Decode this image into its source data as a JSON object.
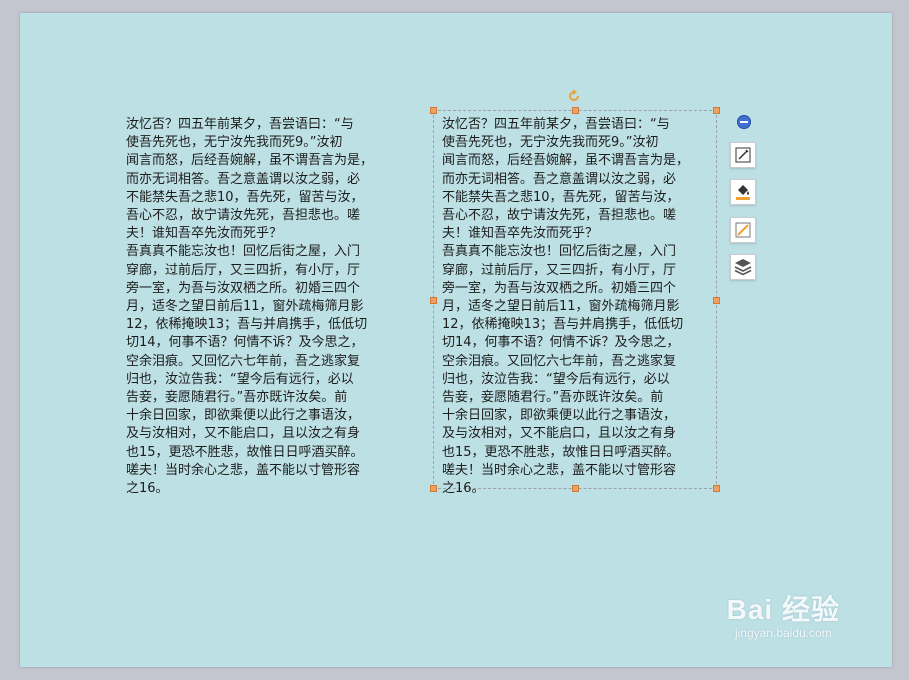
{
  "text_boxes": {
    "left": "汝忆否？四五年前某夕，吾尝语曰：“与\n使吾先死也，无宁汝先我而死9。”汝初\n闻言而怒，后经吾婉解，虽不谓吾言为是，\n而亦无词相答。吾之意盖谓以汝之弱，必\n不能禁失吾之悲10，吾先死，留苦与汝，\n吾心不忍，故宁请汝先死，吾担悲也。嗟\n夫！谁知吾卒先汝而死乎？\n吾真真不能忘汝也！回忆后街之屋，入门\n穿廊，过前后厅，又三四折，有小厅，厅\n旁一室，为吾与汝双栖之所。初婚三四个\n月，适冬之望日前后11，窗外疏梅筛月影\n12，依稀掩映13；吾与并肩携手，低低切\n切14，何事不语？何情不诉？及今思之，\n空余泪痕。又回忆六七年前，吾之逃家复\n归也，汝泣告我：“望今后有远行，必以\n告妾，妾愿随君行。”吾亦既许汝矣。前\n十余日回家，即欲乘便以此行之事语汝，\n及与汝相对，又不能启口，且以汝之有身\n也15，更恐不胜悲，故惟日日呼酒买醉。\n嗟夫！当时余心之悲，盖不能以寸管形容\n之16。",
    "right": "汝忆否？四五年前某夕，吾尝语曰：“与\n使吾先死也，无宁汝先我而死9。”汝初\n闻言而怒，后经吾婉解，虽不谓吾言为是，\n而亦无词相答。吾之意盖谓以汝之弱，必\n不能禁失吾之悲10，吾先死，留苦与汝，\n吾心不忍，故宁请汝先死，吾担悲也。嗟\n夫！谁知吾卒先汝而死乎？\n吾真真不能忘汝也！回忆后街之屋，入门\n穿廊，过前后厅，又三四折，有小厅，厅\n旁一室，为吾与汝双栖之所。初婚三四个\n月，适冬之望日前后11，窗外疏梅筛月影\n12，依稀掩映13；吾与并肩携手，低低切\n切14，何事不语？何情不诉？及今思之，\n空余泪痕。又回忆六七年前，吾之逃家复\n归也，汝泣告我：“望今后有远行，必以\n告妾，妾愿随君行。”吾亦既许汝矣。前\n十余日回家，即欲乘便以此行之事语汝，\n及与汝相对，又不能启口，且以汝之有身\n也15，更恐不胜悲，故惟日日呼酒买醉。\n嗟夫！当时余心之悲，盖不能以寸管形容\n之16。"
  },
  "toolbar": {
    "icons": [
      "collapse-icon",
      "edit-shape-icon",
      "fill-color-icon",
      "outline-color-icon",
      "layers-icon"
    ]
  },
  "watermark": {
    "main": "Bai 经验",
    "sub": "jingyan.baidu.com"
  },
  "colors": {
    "slide_background": "#bde0e5",
    "workspace_background": "#c3c5cf",
    "handle": "#f0a060",
    "accent_blue": "#3f6fd1"
  }
}
